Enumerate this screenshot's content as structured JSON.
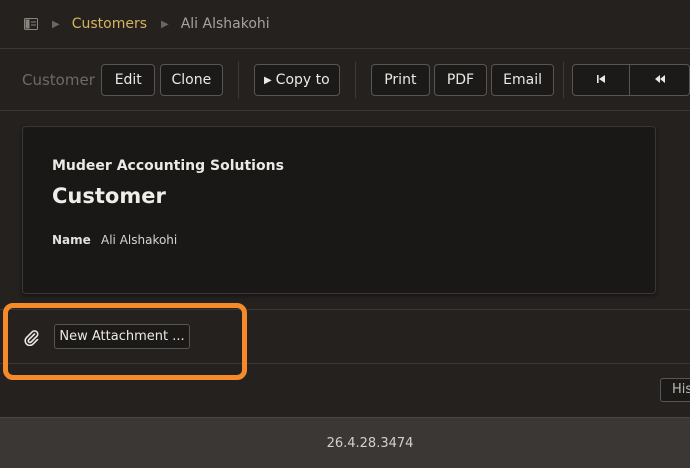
{
  "breadcrumb": {
    "sidebar_icon": "sidebar-toggle-icon",
    "separator": "▶",
    "parent": "Customers",
    "current": "Ali Alshakohi"
  },
  "toolbar": {
    "title": "Customer",
    "edit": "Edit",
    "clone": "Clone",
    "copy_to_icon": "▶",
    "copy_to": "Copy to",
    "print": "Print",
    "pdf": "PDF",
    "email": "Email",
    "first_icon": "skip-to-first-icon",
    "prev_icon": "rewind-icon"
  },
  "document": {
    "company": "Mudeer Accounting Solutions",
    "title": "Customer",
    "name_label": "Name",
    "name_value": "Ali Alshakohi"
  },
  "attachments": {
    "icon": "paperclip-icon",
    "new_button": "New Attachment ..."
  },
  "history_button": "History",
  "footer": {
    "version": "26.4.28.3474"
  },
  "colors": {
    "accent_link": "#d6b45e",
    "highlight": "#f58a2a",
    "background": "#24211f"
  }
}
